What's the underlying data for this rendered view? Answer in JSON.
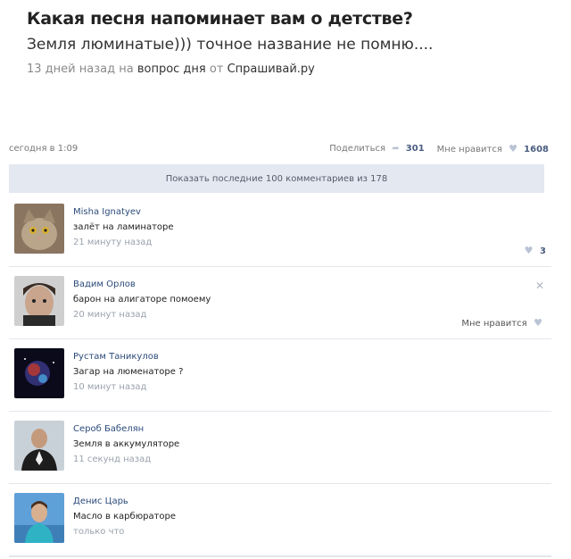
{
  "post": {
    "question": "Какая песня напоминает вам о детстве?",
    "answer": "Земля люминатые))) точное название не помню....",
    "meta_prefix": "13 дней назад на",
    "meta_section": "вопрос дня",
    "meta_from": "от",
    "meta_site": "Спрашивай.ру"
  },
  "bar": {
    "date": "сегодня в 1:09",
    "share_label": "Поделиться",
    "share_count": "301",
    "like_label": "Мне нравится",
    "like_count": "1608"
  },
  "show_all": "Показать последние 100 комментариев из 178",
  "comments": [
    {
      "name": "Misha Ignatyev",
      "text": "залёт на ламинаторе",
      "time": "21 минуту назад",
      "likes": "3"
    },
    {
      "name": "Вадим Орлов",
      "text": "барон на алигаторе помоему",
      "time": "20 минут назад",
      "like_label": "Мне нравится"
    },
    {
      "name": "Рустам Таникулов",
      "text": "Загар на люменаторе ?",
      "time": "10 минут назад"
    },
    {
      "name": "Сероб Бабелян",
      "text": "Земля в аккумуляторе",
      "time": "11 секунд назад"
    },
    {
      "name": "Денис Царь",
      "text": "Масло в карбюраторе",
      "time": "только что"
    }
  ]
}
